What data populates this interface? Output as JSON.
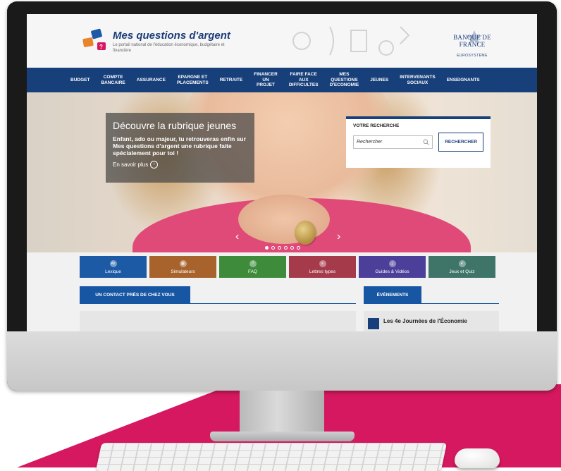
{
  "site": {
    "logo_title": "Mes questions d'argent",
    "logo_subtitle": "Le portail national de l'éducation économique, budgétaire et financière",
    "partner_name": "BANQUE DE FRANCE",
    "partner_sub": "EUROSYSTÈME"
  },
  "nav": [
    {
      "label": "BUDGET"
    },
    {
      "label": "COMPTE\nBANCAIRE"
    },
    {
      "label": "ASSURANCE"
    },
    {
      "label": "EPARGNE ET\nPLACEMENTS"
    },
    {
      "label": "RETRAITE"
    },
    {
      "label": "FINANCER\nUN\nPROJET"
    },
    {
      "label": "FAIRE FACE\nAUX\nDIFFICULTES"
    },
    {
      "label": "MES\nQUESTIONS\nD'ECONOMIE"
    },
    {
      "label": "JEUNES"
    },
    {
      "label": "INTERVENANTS\nSOCIAUX"
    },
    {
      "label": "ENSEIGNANTS"
    }
  ],
  "hero": {
    "title": "Découvre la rubrique jeunes",
    "text": "Enfant, ado ou majeur, tu retrouveras enfin sur Mes questions d'argent une rubrique faite spécialement pour toi !",
    "link": "En savoir plus",
    "dots_total": 6,
    "dots_active": 1
  },
  "search": {
    "label": "VOTRE RECHERCHE",
    "placeholder": "Rechercher",
    "button": "RECHERCHER"
  },
  "tiles": [
    {
      "label": "Lexique",
      "icon": "az-icon",
      "glyph": "Az",
      "color": "#1c5aa6"
    },
    {
      "label": "Simulateurs",
      "icon": "calculator-icon",
      "glyph": "▦",
      "color": "#a8632c"
    },
    {
      "label": "FAQ",
      "icon": "question-icon",
      "glyph": "?",
      "color": "#3d8b3b"
    },
    {
      "label": "Lettres types",
      "icon": "document-icon",
      "glyph": "≡",
      "color": "#a53a4a"
    },
    {
      "label": "Guides & Vidéos",
      "icon": "download-icon",
      "glyph": "⤓",
      "color": "#4b3f9a"
    },
    {
      "label": "Jeux et Quiz",
      "icon": "check-icon",
      "glyph": "✔",
      "color": "#3f7569"
    }
  ],
  "sections": {
    "contact": "UN CONTACT PRÈS DE CHEZ VOUS",
    "events": "ÉVÉNEMENTS",
    "event_text": "Les 4e Journées de l'Économie"
  },
  "colors": {
    "nav_bg": "#173f7a",
    "accent": "#1756a3",
    "floor": "#d5185f"
  }
}
